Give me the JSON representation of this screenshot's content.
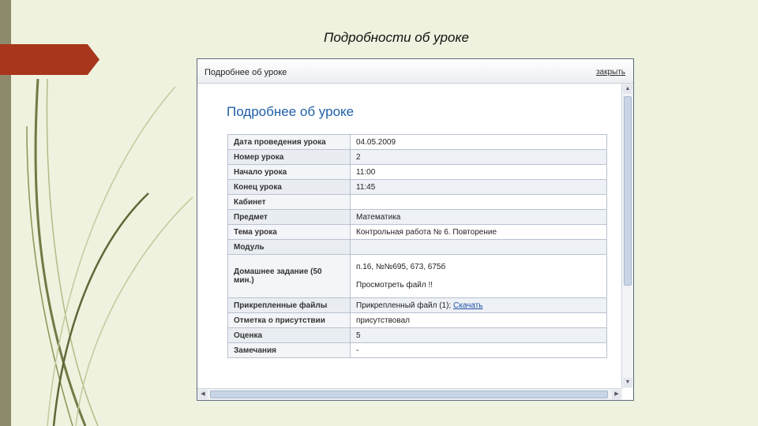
{
  "slide": {
    "title": "Подробности об уроке"
  },
  "window": {
    "title": "Подробнее об уроке",
    "close_label": "закрыть"
  },
  "content": {
    "heading": "Подробнее об уроке",
    "rows": [
      {
        "label": "Дата проведения урока",
        "value": "04.05.2009"
      },
      {
        "label": "Номер урока",
        "value": "2"
      },
      {
        "label": "Начало урока",
        "value": "11:00"
      },
      {
        "label": "Конец урока",
        "value": "11:45"
      },
      {
        "label": "Кабинет",
        "value": ""
      },
      {
        "label": "Предмет",
        "value": "Математика"
      },
      {
        "label": "Тема урока",
        "value": "Контрольная работа № 6. Повторение"
      },
      {
        "label": "Модуль",
        "value": ""
      },
      {
        "label": "Домашнее задание (50 мин.)",
        "value": "п.16, №№695, 673, 675б",
        "value2": "Просмотреть файл !!"
      },
      {
        "label": "Прикрепленные файлы",
        "value": "Прикрепленный файл (1);",
        "link": "Скачать"
      },
      {
        "label": "Отметка о присутствии",
        "value": "присутствовал"
      },
      {
        "label": "Оценка",
        "value": "5"
      },
      {
        "label": "Замечания",
        "value": "-"
      }
    ]
  },
  "icons": {
    "scroll_up": "arrow-up-icon",
    "scroll_down": "arrow-down-icon",
    "scroll_left": "arrow-left-icon",
    "scroll_right": "arrow-right-icon"
  },
  "colors": {
    "accent_arrow": "#a8361c",
    "heading": "#1f5fa8",
    "slide_bg": "#eef2de"
  }
}
